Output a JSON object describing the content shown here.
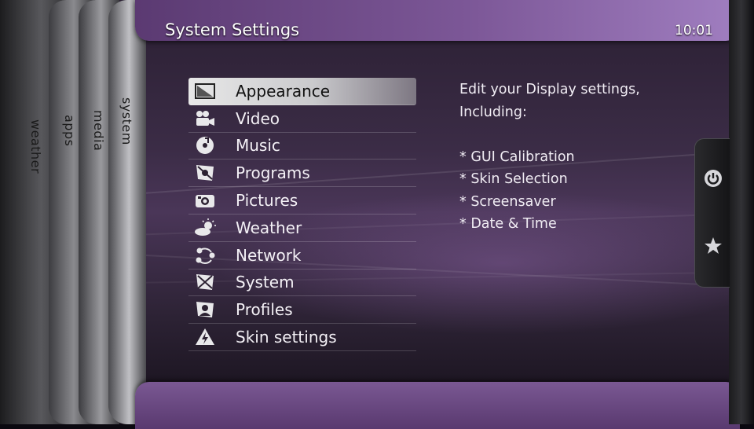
{
  "header": {
    "title": "System Settings",
    "clock": "10:01"
  },
  "tabs": [
    {
      "label": "weather"
    },
    {
      "label": "apps"
    },
    {
      "label": "media"
    },
    {
      "label": "system"
    }
  ],
  "menu": {
    "items": [
      {
        "label": "Appearance",
        "icon": "appearance-icon"
      },
      {
        "label": "Video",
        "icon": "video-camera-icon"
      },
      {
        "label": "Music",
        "icon": "music-disc-icon"
      },
      {
        "label": "Programs",
        "icon": "programs-icon"
      },
      {
        "label": "Pictures",
        "icon": "camera-icon"
      },
      {
        "label": "Weather",
        "icon": "weather-icon"
      },
      {
        "label": "Network",
        "icon": "network-icon"
      },
      {
        "label": "System",
        "icon": "system-icon"
      },
      {
        "label": "Profiles",
        "icon": "profiles-icon"
      },
      {
        "label": "Skin settings",
        "icon": "skin-settings-icon"
      }
    ],
    "focused": "Appearance"
  },
  "description": {
    "lines": [
      "Edit your Display settings,",
      "Including:",
      "",
      "* GUI Calibration",
      "* Skin Selection",
      "* Screensaver",
      "* Date & Time"
    ]
  },
  "side_buttons": [
    {
      "icon": "power-icon"
    },
    {
      "icon": "star-icon"
    }
  ],
  "colors": {
    "accent": "#7c5797",
    "header": "#a07ec0",
    "focus": "#d6d6d9"
  }
}
